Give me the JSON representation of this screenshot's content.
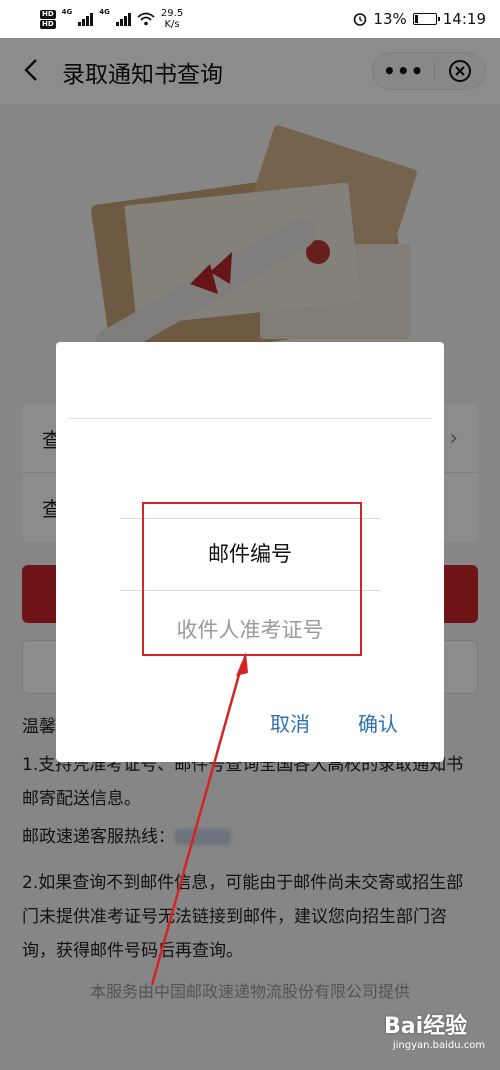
{
  "status_bar": {
    "network_badges": [
      "HD",
      "HD"
    ],
    "signal_labels": [
      "4G",
      "4G"
    ],
    "speed_value": "29.5",
    "speed_unit": "K/s",
    "battery": "13%",
    "battery_level": 0.13,
    "time": "14:19"
  },
  "header": {
    "title": "录取通知书查询",
    "more_label": "•••",
    "icons": [
      "back-icon",
      "more-icon",
      "close-icon"
    ]
  },
  "form": {
    "row1_label": "查",
    "row2_label": "查",
    "row1_chevron": "›"
  },
  "tips": {
    "title_partial": "温馨",
    "line1": "1.支持凭准考证号、邮件号查询全国各大高校的录取通知书邮寄配送信息。",
    "hotline_label": "邮政速递客服热线：",
    "line2": "2.如果查询不到邮件信息，可能由于邮件尚未交寄或招生部门未提供准考证号无法链接到邮件，建议您向招生部门咨询，获得邮件号码后再查询。"
  },
  "footer": "本服务由中国邮政速递物流股份有限公司提供",
  "dialog": {
    "option_1": "邮件编号",
    "option_2": "收件人准考证号",
    "cancel": "取消",
    "confirm": "确认"
  },
  "watermark": {
    "logo": "Bai经验",
    "site": "jingyan.baidu.com"
  },
  "colors": {
    "accent_red": "#c8252b",
    "dialog_button_blue": "#2f6fb6",
    "annotation_red": "#d62424"
  }
}
